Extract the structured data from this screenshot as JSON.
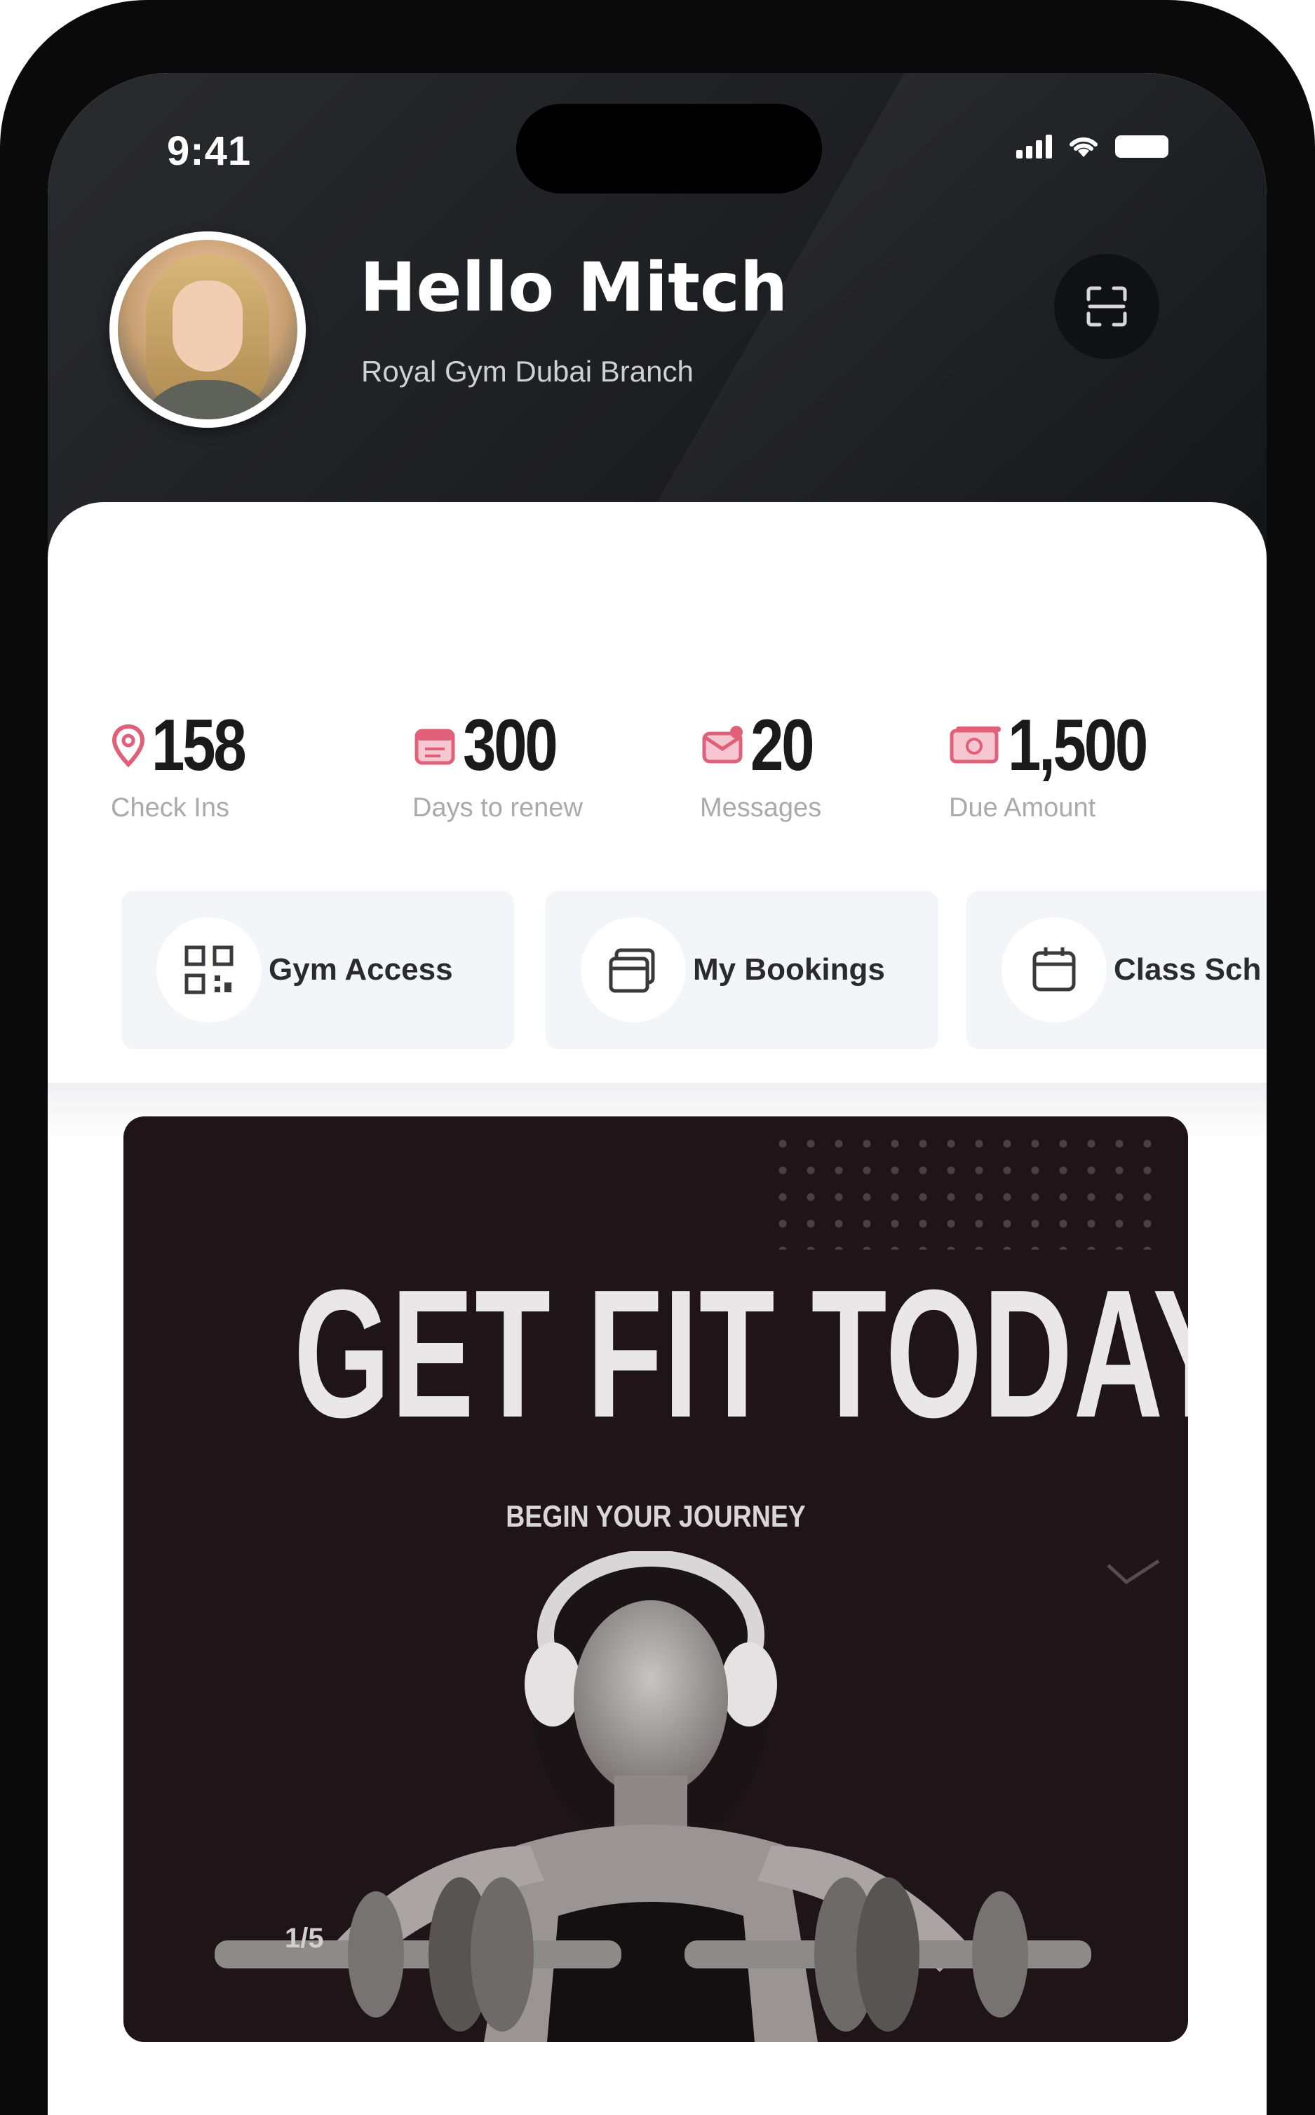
{
  "status_bar": {
    "time": "9:41"
  },
  "header": {
    "greeting": "Hello Mitch",
    "branch": "Royal Gym Dubai Branch",
    "avatar_icon": "user-avatar",
    "scan_icon": "scan-icon"
  },
  "stats": [
    {
      "icon": "location-pin-icon",
      "value": "158",
      "label": "Check Ins"
    },
    {
      "icon": "calendar-icon",
      "value": "300",
      "label": "Days to renew"
    },
    {
      "icon": "message-icon",
      "value": "20",
      "label": "Messages"
    },
    {
      "icon": "payment-icon",
      "value": "1,500",
      "label": "Due Amount"
    }
  ],
  "shortcuts": [
    {
      "icon": "qr-code-icon",
      "label": "Gym Access"
    },
    {
      "icon": "bookings-icon",
      "label": "My Bookings"
    },
    {
      "icon": "calendar-icon",
      "label": "Class Sch"
    }
  ],
  "banner": {
    "title": "GET FIT TODAY",
    "subtitle": "BEGIN YOUR JOURNEY",
    "counter": "1/5"
  },
  "colors": {
    "accent": "#e0607a",
    "header_dark": "#1c1d21",
    "banner_bg": "#1f1418"
  }
}
